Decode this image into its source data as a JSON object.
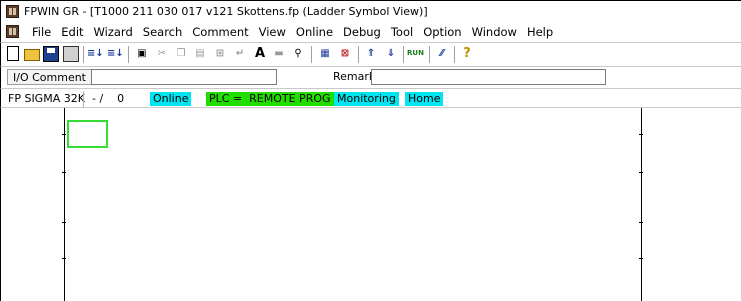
{
  "window": {
    "title": "FPWIN GR - [T1000 211 030 017 v121 Skottens.fp (Ladder Symbol View)]",
    "app_icon": "fpwin-app-icon"
  },
  "menu": {
    "items": [
      "File",
      "Edit",
      "Wizard",
      "Search",
      "Comment",
      "View",
      "Online",
      "Debug",
      "Tool",
      "Option",
      "Window",
      "Help"
    ]
  },
  "toolbar": {
    "icons": [
      "new-file-icon",
      "open-folder-icon",
      "save-icon",
      "print-icon",
      "compile-icon",
      "compile-all-icon",
      "select-icon",
      "cut-icon",
      "copy-icon",
      "paste-icon",
      "insert-column-icon",
      "insert-line-icon",
      "text-a-icon",
      "block-icon",
      "find-icon",
      "monitor-panel-icon",
      "register-icon",
      "plc-read-icon",
      "plc-write-icon",
      "run-icon",
      "prog-mode-icon",
      "help-icon"
    ],
    "run_label": "RUN"
  },
  "comment_bar": {
    "io_comment_label": "I/O Comment",
    "io_comment_value": "",
    "remark_label": "Remark",
    "remark_value": ""
  },
  "status_bar": {
    "plc_model": "FP SIGMA 32K",
    "step_info": "- /    0",
    "online": "Online",
    "plc_mode": "PLC =  REMOTE PROG",
    "monitoring": "Monitoring",
    "home": "Home",
    "colors": {
      "online_bg": "#00e5ef",
      "plc_mode_bg": "#22dd00",
      "monitoring_bg": "#00e5ef",
      "home_bg": "#00e5ef"
    }
  },
  "ladder": {
    "cursor_color": "#33dd33"
  }
}
